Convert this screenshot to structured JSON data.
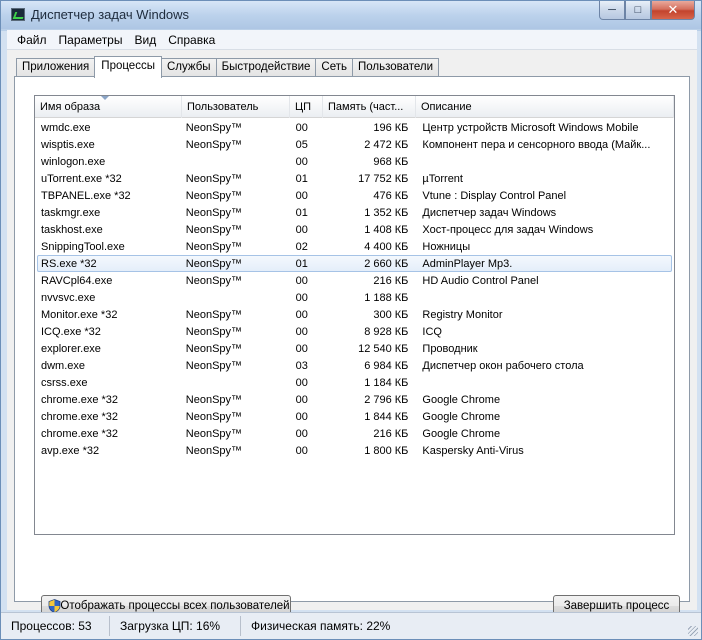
{
  "window": {
    "title": "Диспетчер задач Windows"
  },
  "menu": [
    "Файл",
    "Параметры",
    "Вид",
    "Справка"
  ],
  "tabs": [
    {
      "label": "Приложения",
      "active": false
    },
    {
      "label": "Процессы",
      "active": true
    },
    {
      "label": "Службы",
      "active": false
    },
    {
      "label": "Быстродействие",
      "active": false
    },
    {
      "label": "Сеть",
      "active": false
    },
    {
      "label": "Пользователи",
      "active": false
    }
  ],
  "columns": [
    "Имя образа",
    "Пользователь",
    "ЦП",
    "Память (част...",
    "Описание"
  ],
  "selected_index": 8,
  "processes": [
    [
      "wmdc.exe",
      "NeonSpy™",
      "00",
      "196 КБ",
      "Центр устройств Microsoft Windows Mobile"
    ],
    [
      "wisptis.exe",
      "NeonSpy™",
      "05",
      "2 472 КБ",
      "Компонент пера и сенсорного ввода (Майк..."
    ],
    [
      "winlogon.exe",
      "",
      "00",
      "968 КБ",
      ""
    ],
    [
      "uTorrent.exe *32",
      "NeonSpy™",
      "01",
      "17 752 КБ",
      "µTorrent"
    ],
    [
      "TBPANEL.exe *32",
      "NeonSpy™",
      "00",
      "476 КБ",
      "Vtune : Display Control Panel"
    ],
    [
      "taskmgr.exe",
      "NeonSpy™",
      "01",
      "1 352 КБ",
      "Диспетчер задач Windows"
    ],
    [
      "taskhost.exe",
      "NeonSpy™",
      "00",
      "1 408 КБ",
      "Хост-процесс для задач Windows"
    ],
    [
      "SnippingTool.exe",
      "NeonSpy™",
      "02",
      "4 400 КБ",
      "Ножницы"
    ],
    [
      "RS.exe *32",
      "NeonSpy™",
      "01",
      "2 660 КБ",
      "AdminPlayer Mp3."
    ],
    [
      "RAVCpl64.exe",
      "NeonSpy™",
      "00",
      "216 КБ",
      "HD Audio Control Panel"
    ],
    [
      "nvvsvc.exe",
      "",
      "00",
      "1 188 КБ",
      ""
    ],
    [
      "Monitor.exe *32",
      "NeonSpy™",
      "00",
      "300 КБ",
      "Registry Monitor"
    ],
    [
      "ICQ.exe *32",
      "NeonSpy™",
      "00",
      "8 928 КБ",
      "ICQ"
    ],
    [
      "explorer.exe",
      "NeonSpy™",
      "00",
      "12 540 КБ",
      "Проводник"
    ],
    [
      "dwm.exe",
      "NeonSpy™",
      "03",
      "6 984 КБ",
      "Диспетчер окон рабочего стола"
    ],
    [
      "csrss.exe",
      "",
      "00",
      "1 184 КБ",
      ""
    ],
    [
      "chrome.exe *32",
      "NeonSpy™",
      "00",
      "2 796 КБ",
      "Google Chrome"
    ],
    [
      "chrome.exe *32",
      "NeonSpy™",
      "00",
      "1 844 КБ",
      "Google Chrome"
    ],
    [
      "chrome.exe *32",
      "NeonSpy™",
      "00",
      "216 КБ",
      "Google Chrome"
    ],
    [
      "avp.exe *32",
      "NeonSpy™",
      "00",
      "1 800 КБ",
      "Kaspersky Anti-Virus"
    ]
  ],
  "buttons": {
    "show_all": "Отображать процессы всех пользователей",
    "end_process": "Завершить процесс"
  },
  "status": {
    "processes": "Процессов: 53",
    "cpu": "Загрузка ЦП: 16%",
    "memory": "Физическая память: 22%"
  }
}
